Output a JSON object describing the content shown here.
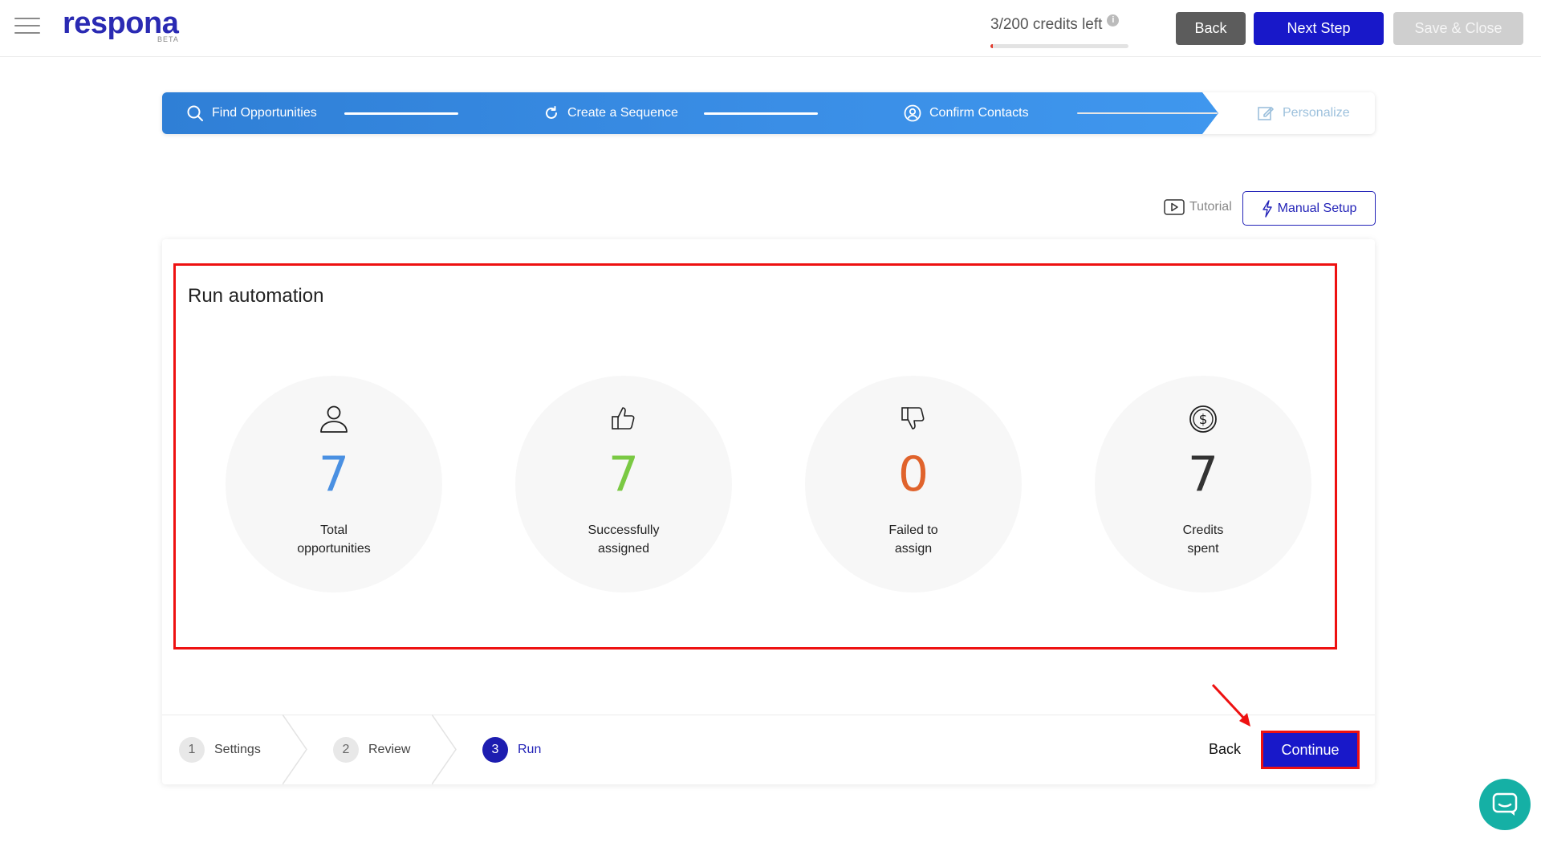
{
  "header": {
    "logo": "respona",
    "logo_badge": "BETA",
    "credits_text": "3/200 credits left",
    "credits_used_fraction": 0.015,
    "buttons": {
      "back": "Back",
      "next_step": "Next Step",
      "save_close": "Save & Close"
    }
  },
  "stepper": {
    "steps": [
      {
        "label": "Find Opportunities",
        "icon": "search-icon",
        "active": true
      },
      {
        "label": "Create a Sequence",
        "icon": "refresh-icon",
        "active": true
      },
      {
        "label": "Confirm Contacts",
        "icon": "user-circle-icon",
        "active": true
      },
      {
        "label": "Personalize",
        "icon": "edit-icon",
        "active": false
      }
    ]
  },
  "actions": {
    "tutorial": "Tutorial",
    "manual_setup": "Manual Setup"
  },
  "card": {
    "title": "Run automation",
    "stats": [
      {
        "value": "7",
        "label_line1": "Total",
        "label_line2": "opportunities",
        "icon": "user-icon",
        "color": "#4a90e2"
      },
      {
        "value": "7",
        "label_line1": "Successfully",
        "label_line2": "assigned",
        "icon": "thumbs-up-icon",
        "color": "#7ac943"
      },
      {
        "value": "0",
        "label_line1": "Failed to",
        "label_line2": "assign",
        "icon": "thumbs-down-icon",
        "color": "#e0632c"
      },
      {
        "value": "7",
        "label_line1": "Credits",
        "label_line2": "spent",
        "icon": "dollar-coin-icon",
        "color": "#333333"
      }
    ]
  },
  "footer": {
    "tabs": [
      {
        "num": "1",
        "label": "Settings"
      },
      {
        "num": "2",
        "label": "Review"
      },
      {
        "num": "3",
        "label": "Run"
      }
    ],
    "back": "Back",
    "continue": "Continue"
  },
  "colors": {
    "brand": "#1818c9",
    "stepper_blue": "#3a8ee6",
    "highlight_red": "#ee1111",
    "chat": "#15b0a5"
  }
}
